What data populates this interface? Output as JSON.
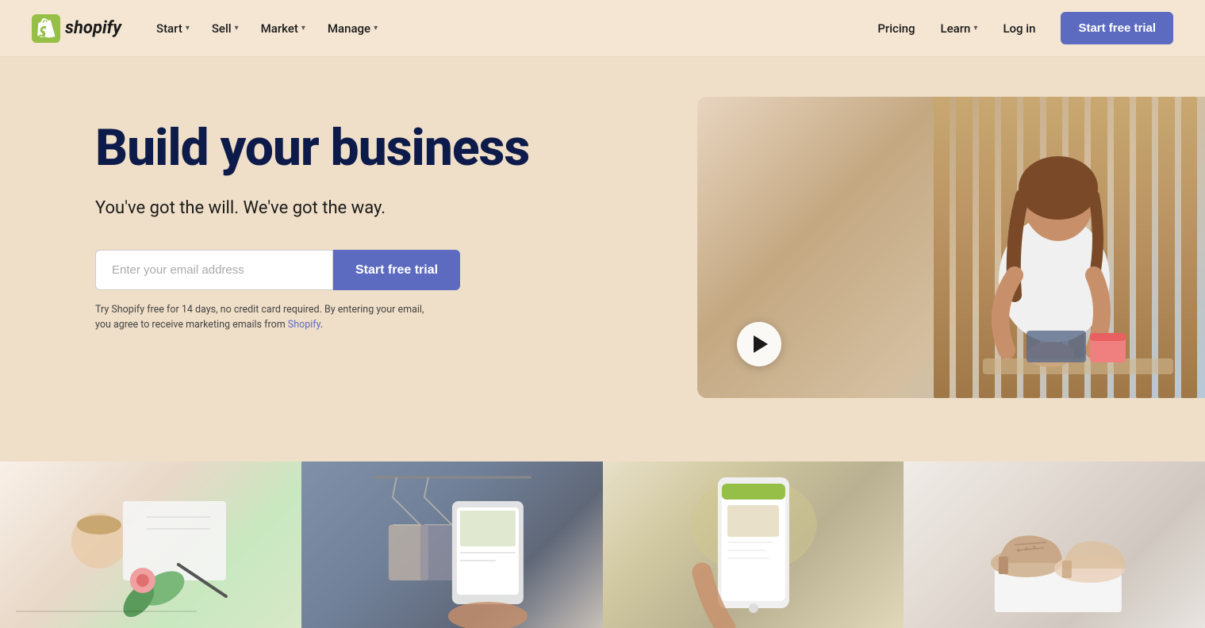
{
  "brand": {
    "name": "shopify",
    "logo_alt": "Shopify"
  },
  "nav": {
    "items_left": [
      {
        "label": "Start",
        "has_dropdown": true
      },
      {
        "label": "Sell",
        "has_dropdown": true
      },
      {
        "label": "Market",
        "has_dropdown": true
      },
      {
        "label": "Manage",
        "has_dropdown": true
      }
    ],
    "items_right": [
      {
        "label": "Pricing",
        "has_dropdown": false
      },
      {
        "label": "Learn",
        "has_dropdown": true
      },
      {
        "label": "Log in",
        "has_dropdown": false
      }
    ],
    "cta_label": "Start free trial"
  },
  "hero": {
    "title": "Build your business",
    "subtitle": "You've got the will. We've got the way.",
    "email_placeholder": "Enter your email address",
    "cta_label": "Start free trial",
    "disclaimer": "Try Shopify free for 14 days, no credit card required. By entering your email, you agree to receive marketing emails from Shopify."
  },
  "bottom_images": [
    {
      "label": "notebook-coffee-image"
    },
    {
      "label": "tablet-clothes-image"
    },
    {
      "label": "phone-shopify-image"
    },
    {
      "label": "shoes-image"
    }
  ]
}
